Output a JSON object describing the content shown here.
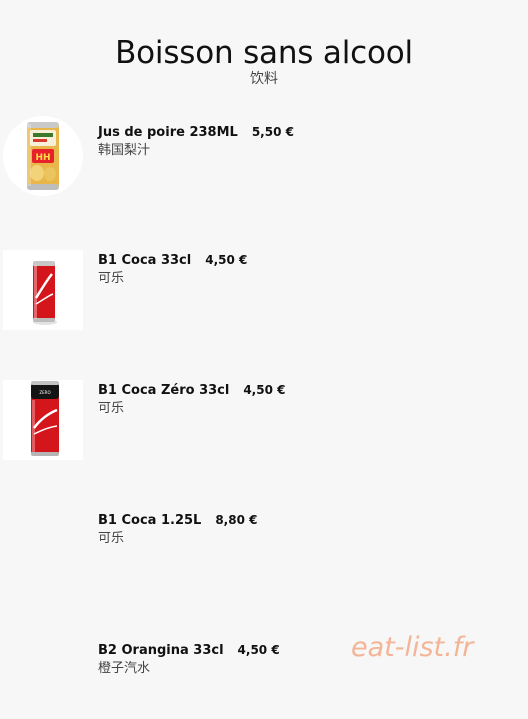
{
  "header": {
    "title": "Boisson sans alcool",
    "subtitle": "饮料"
  },
  "items": [
    {
      "name": "Jus de poire 238ML",
      "price": "5,50 €",
      "desc": "韩国梨汁",
      "image": "pear-juice-can"
    },
    {
      "name": "B1 Coca 33cl",
      "price": "4,50 €",
      "desc": "可乐",
      "image": "coca-cola-can"
    },
    {
      "name": "B1 Coca Zéro 33cl",
      "price": "4,50 €",
      "desc": "可乐",
      "image": "coca-cola-zero-can"
    },
    {
      "name": "B1 Coca 1.25L",
      "price": "8,80 €",
      "desc": "可乐"
    },
    {
      "name": "B2 Orangina 33cl",
      "price": "4,50 €",
      "desc": "橙子汽水"
    }
  ],
  "watermark": "eat-list.fr",
  "colors": {
    "background": "#f7f7f7",
    "watermark": "#f3b596",
    "coca_red": "#d4161c"
  }
}
